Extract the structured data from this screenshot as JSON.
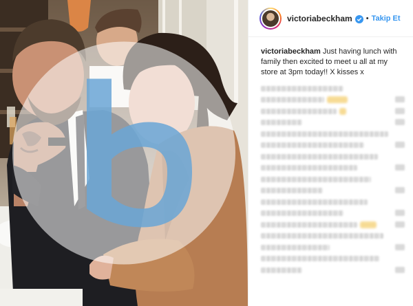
{
  "post": {
    "username": "victoriabeckham",
    "follow_label": "Takip Et",
    "dot": "•",
    "caption_user": "victoriabeckham",
    "caption_text": " Just having lunch with family then excited to meet u all at my store at 3pm today!! X kisses x"
  },
  "colors": {
    "link_blue": "#3897f0",
    "text": "#262626",
    "divider": "#efefef"
  },
  "icons": {
    "verified": "verified-badge-icon",
    "watermark": "site-watermark-logo"
  }
}
